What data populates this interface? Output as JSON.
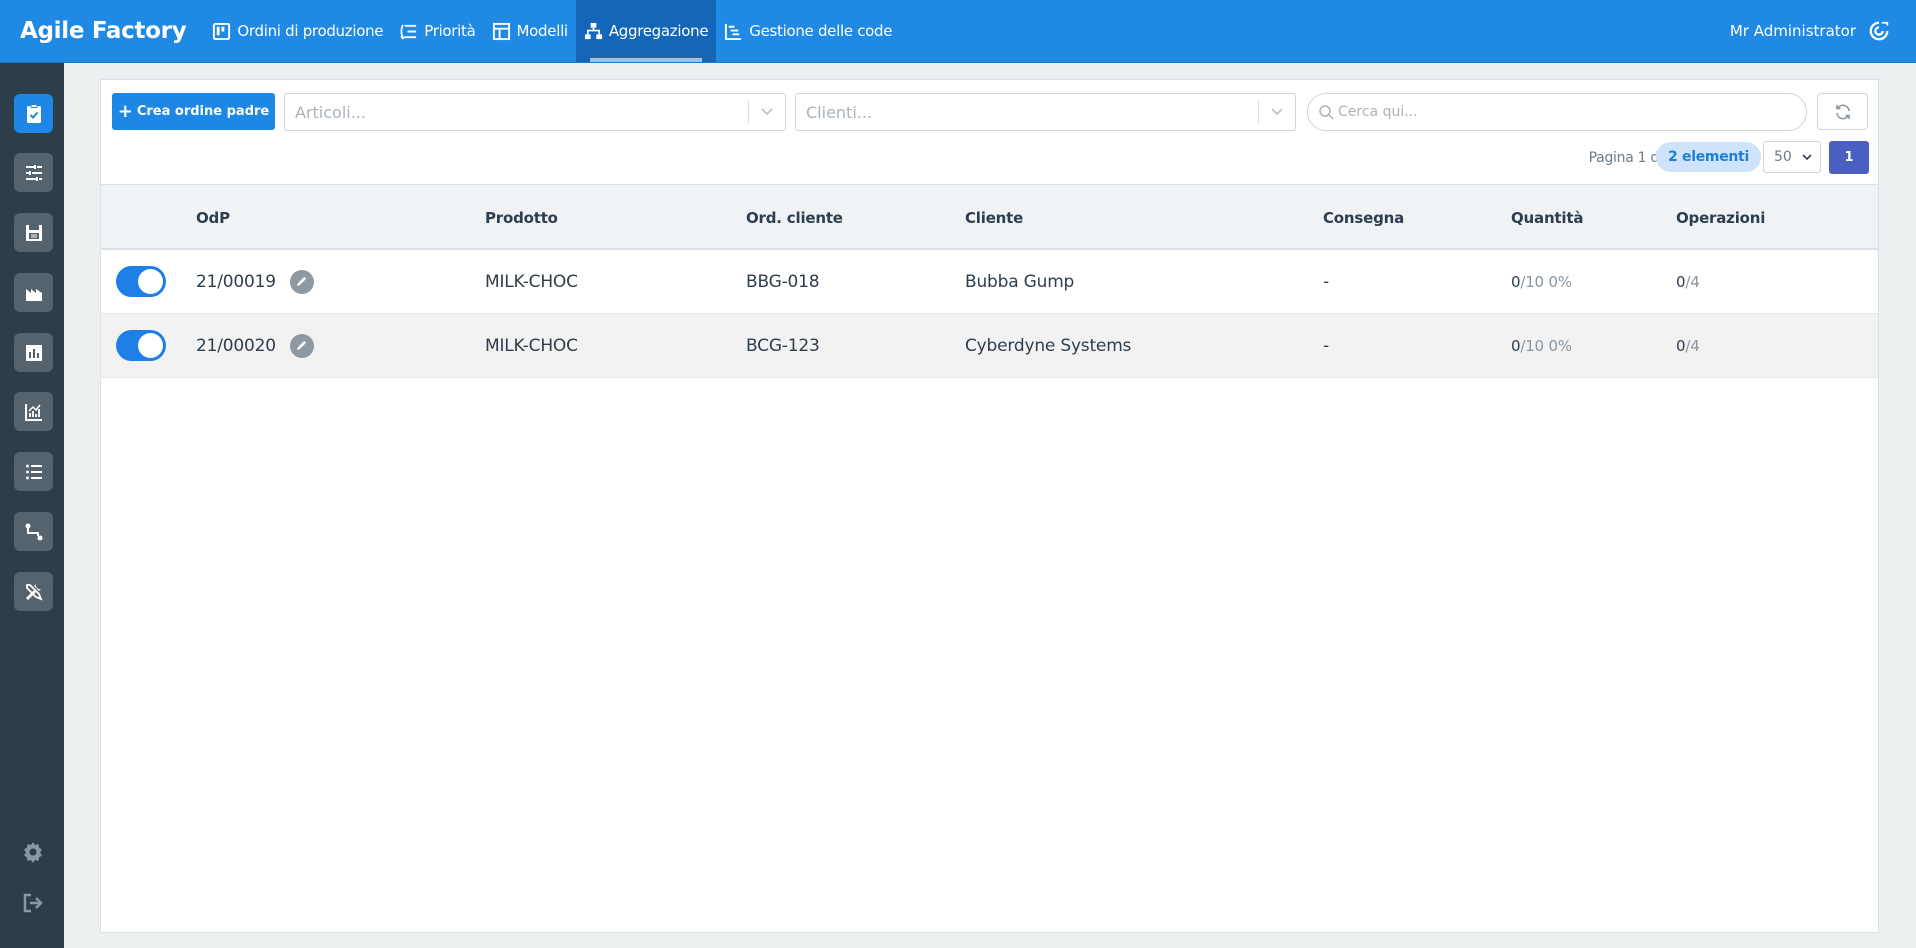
{
  "app": {
    "brand": "Agile Factory",
    "user": "Mr Administrator"
  },
  "nav": [
    {
      "label": "Ordini di produzione",
      "icon": "board-icon",
      "active": false
    },
    {
      "label": "Priorità",
      "icon": "priority-list-icon",
      "active": false
    },
    {
      "label": "Modelli",
      "icon": "template-icon",
      "active": false
    },
    {
      "label": "Aggregazione",
      "icon": "sitemap-icon",
      "active": true
    },
    {
      "label": "Gestione delle code",
      "icon": "gantt-icon",
      "active": false
    }
  ],
  "sidebar": {
    "items": [
      {
        "icon": "clipboard-check-icon",
        "active": true
      },
      {
        "icon": "sliders-icon",
        "active": false
      },
      {
        "icon": "floppy-calendar-icon",
        "active": false
      },
      {
        "icon": "factory-icon",
        "active": false
      },
      {
        "icon": "bar-chart-icon",
        "active": false
      },
      {
        "icon": "line-chart-icon",
        "active": false
      },
      {
        "icon": "list-icon",
        "active": false
      },
      {
        "icon": "route-icon",
        "active": false
      },
      {
        "icon": "tools-icon",
        "active": false
      }
    ],
    "bottom": [
      {
        "icon": "gear-icon"
      },
      {
        "icon": "logout-icon"
      }
    ]
  },
  "toolbar": {
    "create_label": "Crea ordine padre",
    "articoli_placeholder": "Articoli...",
    "clienti_placeholder": "Clienti...",
    "search_placeholder": "Cerca qui...",
    "pager_text": "Pagina 1 di 1",
    "count_badge": "2 elementi",
    "per_page": "50",
    "current_page": "1"
  },
  "table": {
    "columns": [
      "OdP",
      "Prodotto",
      "Ord. cliente",
      "Cliente",
      "Consegna",
      "Quantità",
      "Operazioni"
    ],
    "rows": [
      {
        "odp": "21/00019",
        "prodotto": "MILK-CHOC",
        "ord_cliente": "BBG-018",
        "cliente": "Bubba Gump",
        "consegna": "-",
        "qty_done": "0",
        "qty_total": "/10 0%",
        "ops_done": "0",
        "ops_total": "/4",
        "enabled": true
      },
      {
        "odp": "21/00020",
        "prodotto": "MILK-CHOC",
        "ord_cliente": "BCG-123",
        "cliente": "Cyberdyne Systems",
        "consegna": "-",
        "qty_done": "0",
        "qty_total": "/10 0%",
        "ops_done": "0",
        "ops_total": "/4",
        "enabled": true
      }
    ]
  },
  "colors": {
    "primary": "#2089e3",
    "sidebar": "#2d3e4b",
    "page_btn": "#4a5fc1"
  }
}
